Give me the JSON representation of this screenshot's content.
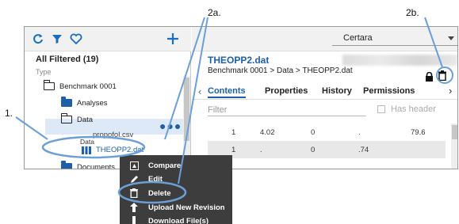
{
  "annotations": {
    "label_1": "1.",
    "label_2a": "2a.",
    "label_2b": "2b."
  },
  "left_panel": {
    "filter_title": "All Filtered (19)",
    "type_label": "Type",
    "tree": [
      {
        "label": "Benchmark 0001",
        "icon": "folder-outline-icon"
      },
      {
        "label": "Analyses",
        "icon": "folder-icon"
      },
      {
        "label": "Data",
        "icon": "folder-outline-icon"
      },
      {
        "label": "propofol.csv",
        "icon": "file-icon"
      },
      {
        "label": "THEOPP2.dat",
        "icon": "data-file-icon"
      },
      {
        "label": "Documents",
        "icon": "folder-icon"
      }
    ],
    "drag_ghost_label": "Data",
    "more_label": "●●●"
  },
  "right_panel": {
    "dropdown_value": "Certara",
    "file_title": "THEOPP2.dat",
    "breadcrumb": "Benchmark 0001 > Data > THEOPP2.dat",
    "tabs": [
      "Contents",
      "Properties",
      "History",
      "Permissions"
    ],
    "filter_placeholder": "Filter",
    "has_header_label": "Has header",
    "rows": [
      [
        "1",
        "4.02",
        "0",
        ".",
        "79.6"
      ],
      [
        "1",
        ".",
        "0",
        ".74",
        ""
      ],
      [
        "",
        "",
        "",
        "",
        ""
      ]
    ]
  },
  "context_menu": {
    "items": [
      "Compare",
      "Edit",
      "Delete",
      "Upload New Revision",
      "Download File(s)"
    ]
  },
  "colors": {
    "accent": "#1d5fa8",
    "annotation": "#6a9fd8",
    "menu_bg": "#3d3d3d"
  }
}
